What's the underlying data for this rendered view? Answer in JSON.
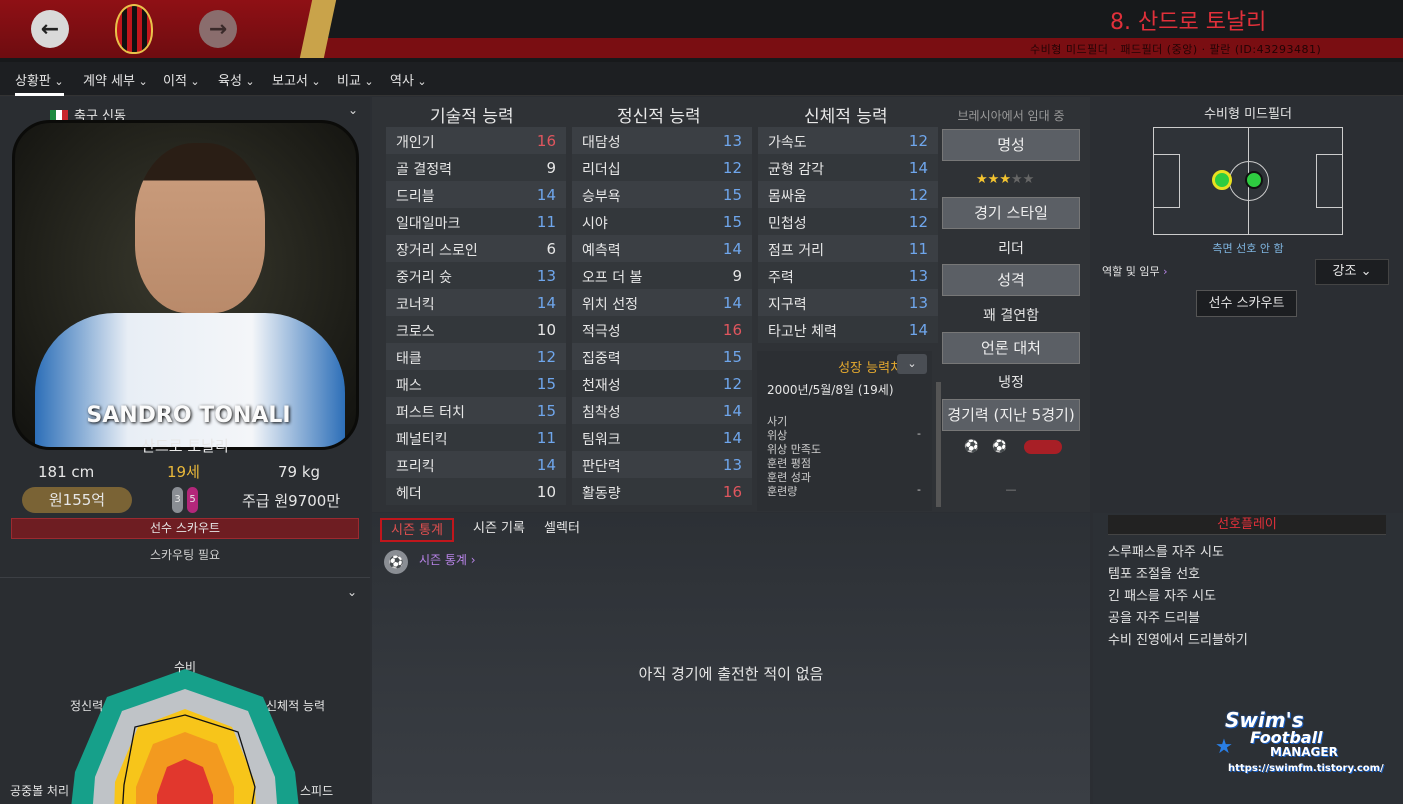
{
  "header": {
    "player_title": "8. 산드로 토날리",
    "subtitle": "수비형 미드필더 · 패드필더 (중앙) · 팔란 (ID:43293481)",
    "back_icon": "arrow-left-icon",
    "forward_icon": "arrow-right-icon",
    "colors": {
      "red": "#8f1015",
      "title": "#e0303a"
    }
  },
  "menu": [
    "상황판",
    "계약 세부",
    "이적",
    "육성",
    "보고서",
    "비교",
    "역사"
  ],
  "profile": {
    "nationality_label": "축구 신동",
    "card_name": "SANDRO TONALI",
    "name": "산드로 토날리",
    "height": "181 cm",
    "age": "19세",
    "weight": "79 kg",
    "value": "원155억",
    "pill_left": "3",
    "pill_right": "5",
    "wage": "주급 원9700만",
    "scout_bar": "선수 스카우트",
    "scout_note": "스카우팅 필요"
  },
  "radar": {
    "labels": [
      "수비",
      "신체적 능력",
      "스피드",
      "공중볼 처리",
      "정신력"
    ]
  },
  "attributes": {
    "technical_title": "기술적 능력",
    "mental_title": "정신적 능력",
    "physical_title": "신체적 능력",
    "technical": [
      {
        "name": "개인기",
        "value": "16"
      },
      {
        "name": "골 결정력",
        "value": "9"
      },
      {
        "name": "드리블",
        "value": "14"
      },
      {
        "name": "일대일마크",
        "value": "11"
      },
      {
        "name": "장거리 스로인",
        "value": "6"
      },
      {
        "name": "중거리 슛",
        "value": "13"
      },
      {
        "name": "코너킥",
        "value": "14"
      },
      {
        "name": "크로스",
        "value": "10"
      },
      {
        "name": "태클",
        "value": "12"
      },
      {
        "name": "패스",
        "value": "15"
      },
      {
        "name": "퍼스트 터치",
        "value": "15"
      },
      {
        "name": "페널티킥",
        "value": "11"
      },
      {
        "name": "프리킥",
        "value": "14"
      },
      {
        "name": "헤더",
        "value": "10"
      }
    ],
    "mental": [
      {
        "name": "대담성",
        "value": "13"
      },
      {
        "name": "리더십",
        "value": "12"
      },
      {
        "name": "승부욕",
        "value": "15"
      },
      {
        "name": "시야",
        "value": "15"
      },
      {
        "name": "예측력",
        "value": "14"
      },
      {
        "name": "오프 더 볼",
        "value": "9"
      },
      {
        "name": "위치 선정",
        "value": "14"
      },
      {
        "name": "적극성",
        "value": "16"
      },
      {
        "name": "집중력",
        "value": "15"
      },
      {
        "name": "천재성",
        "value": "12"
      },
      {
        "name": "침착성",
        "value": "14"
      },
      {
        "name": "팀워크",
        "value": "14"
      },
      {
        "name": "판단력",
        "value": "13"
      },
      {
        "name": "활동량",
        "value": "16"
      }
    ],
    "physical": [
      {
        "name": "가속도",
        "value": "12"
      },
      {
        "name": "균형 감각",
        "value": "14"
      },
      {
        "name": "몸싸움",
        "value": "12"
      },
      {
        "name": "민첩성",
        "value": "12"
      },
      {
        "name": "점프 거리",
        "value": "11"
      },
      {
        "name": "주력",
        "value": "13"
      },
      {
        "name": "지구력",
        "value": "13"
      },
      {
        "name": "타고난 체력",
        "value": "14"
      }
    ],
    "value_colors": {
      "high": "#e0565e",
      "mid": "#6fa6ec",
      "low": "#e6e6e6"
    }
  },
  "growth": {
    "title": "성장 능력치",
    "dob": "2000년/5월/8일 (19세)",
    "items": [
      "사기",
      "위상",
      "위상 만족도",
      "훈련 평점",
      "훈련 성과",
      "훈련량"
    ],
    "dash1": "-",
    "dash2": "-"
  },
  "side": {
    "loan_note": "브레시아에서 임대 중",
    "reputation": "명성",
    "stars": 3,
    "stars_total": 5,
    "play_style": "경기 스타일",
    "play_style_value": "리더",
    "personality": "성격",
    "personality_value": "꽤 결연함",
    "media": "언론 대처",
    "media_value": "냉정",
    "form": "경기력 (지난 5경기)",
    "form_dash": "—"
  },
  "position": {
    "title": "수비형 미드필더",
    "note": "측면 선호 안 함",
    "role_link": "역할 및 임무",
    "emphasis": "강조",
    "scout_button": "선수 스카우트"
  },
  "stats": {
    "tabs": [
      "시즌 통계",
      "시즌 기록",
      "셀렉터"
    ],
    "link": "시즌 통계",
    "empty": "아직 경기에 출전한 적이 없음"
  },
  "preferences": {
    "title": "선호플레이",
    "items": [
      "스루패스를 자주 시도",
      "템포 조절을 선호",
      "긴 패스를 자주 시도",
      "공을 자주 드리블",
      "수비 진영에서 드리블하기"
    ]
  },
  "watermark": {
    "line1": "Swim's",
    "line2": "Football",
    "line3": "MANAGER",
    "url": "https://swimfm.tistory.com/"
  }
}
